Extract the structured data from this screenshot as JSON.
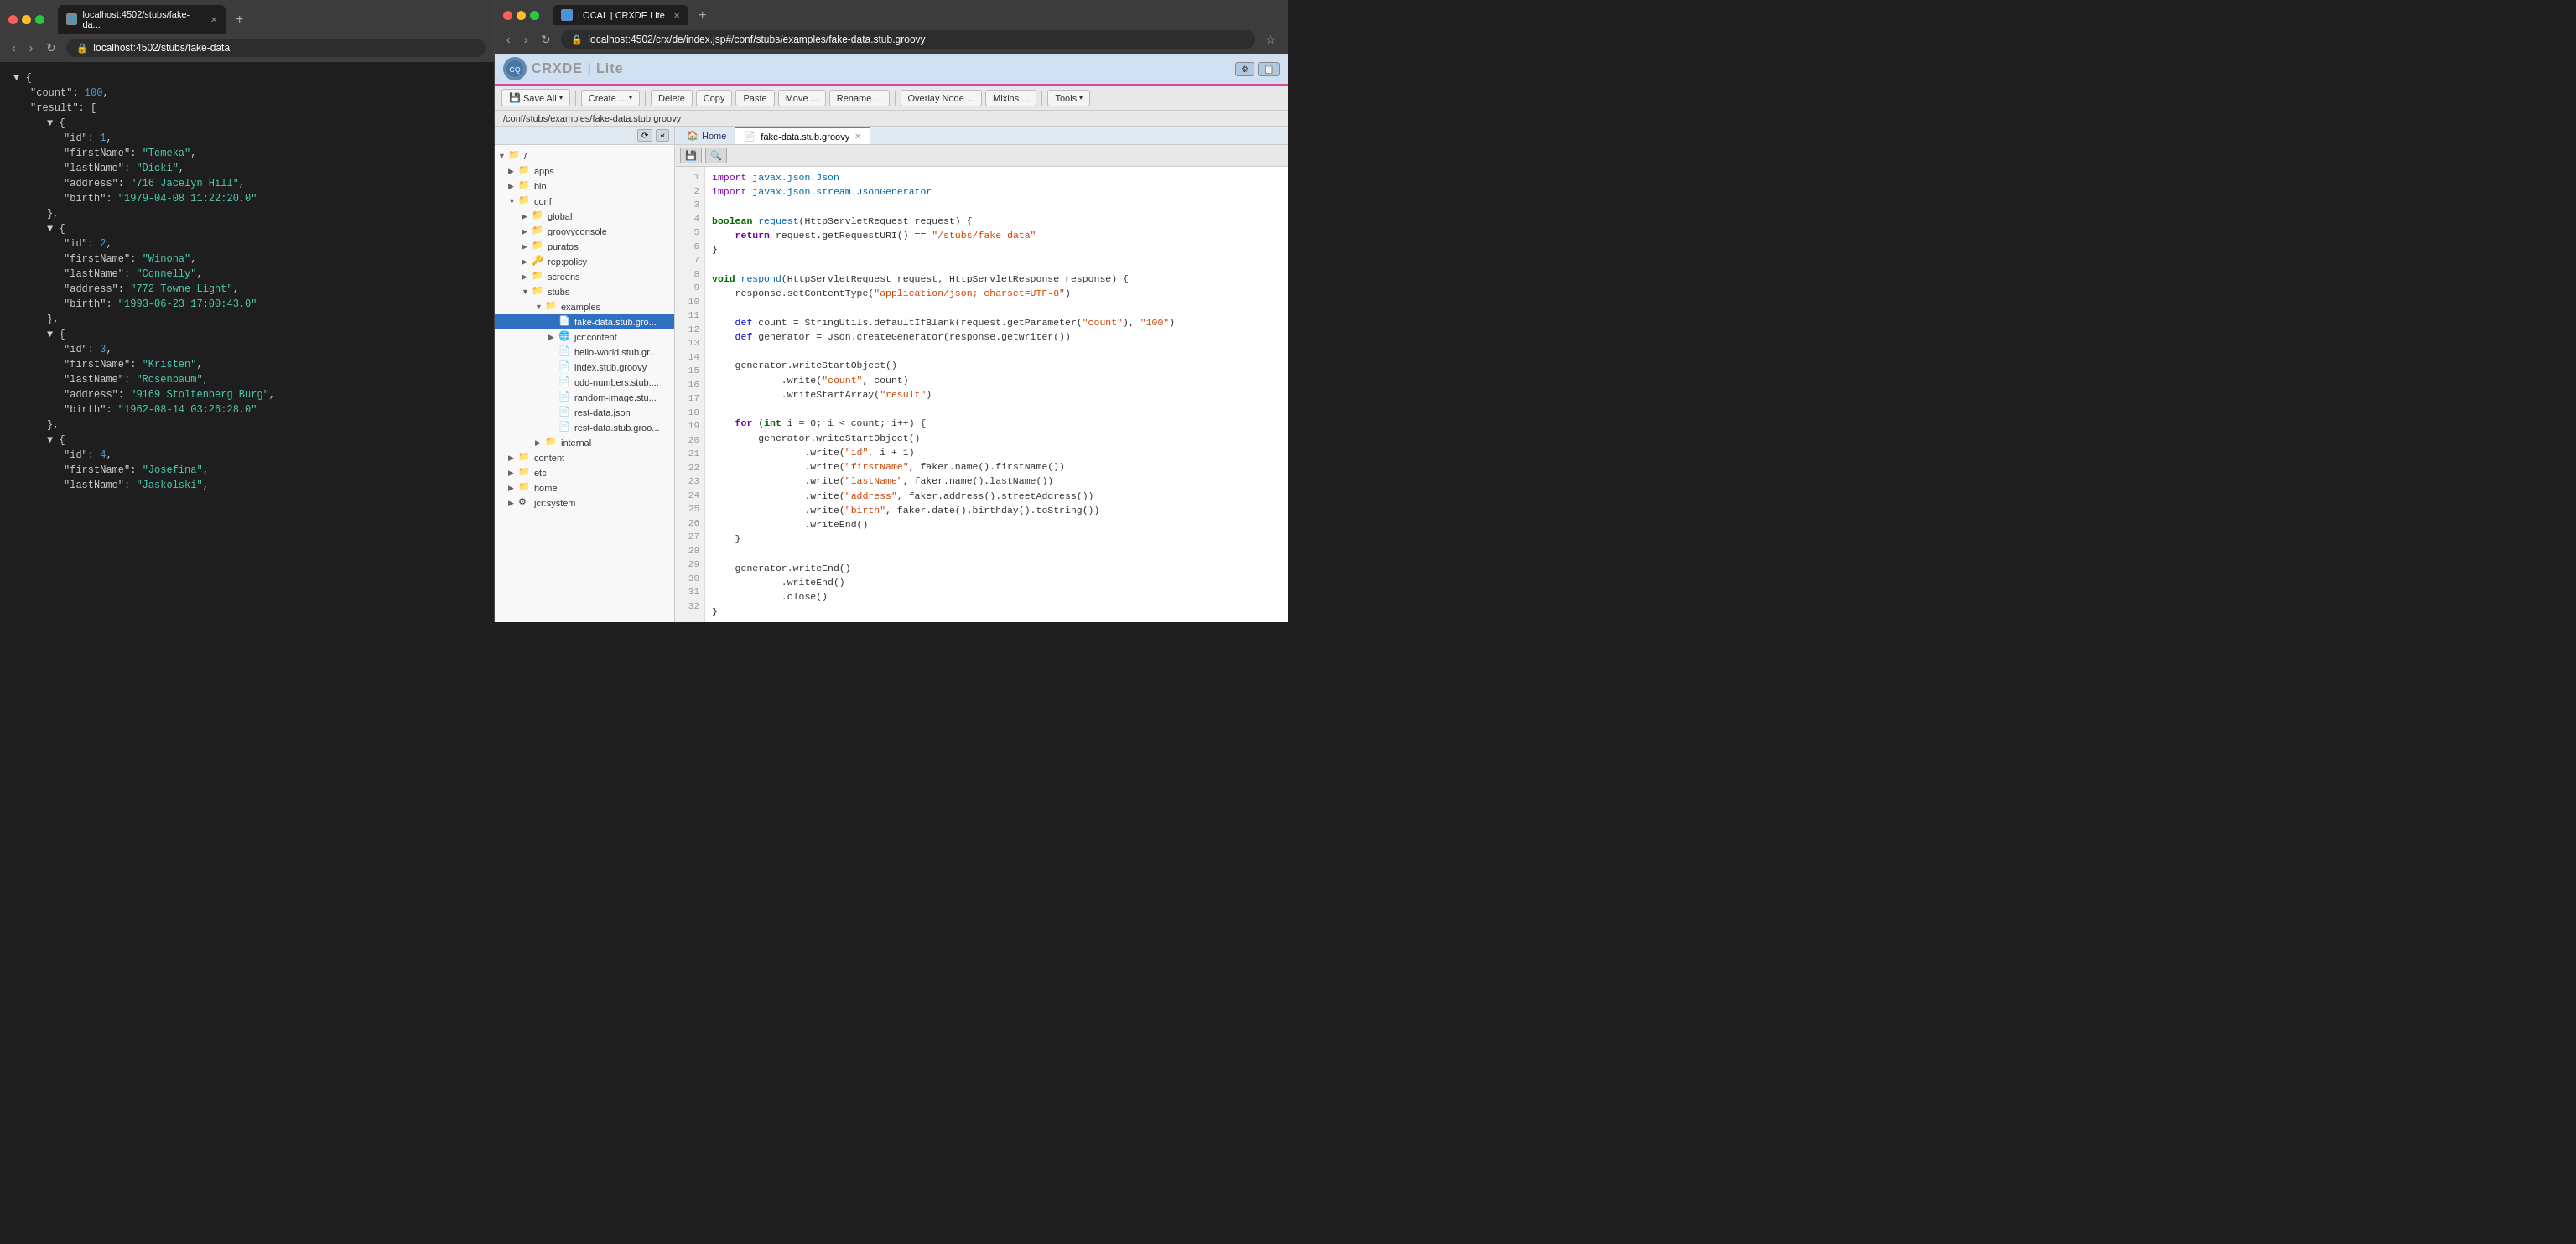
{
  "left_browser": {
    "tab_url": "localhost:4502/stubs/fake-da...",
    "address": "localhost:4502/stubs/fake-data",
    "json_lines": [
      {
        "indent": 0,
        "text": "▼ {"
      },
      {
        "indent": 1,
        "text": "\"count\": ",
        "number": "100",
        "suffix": ","
      },
      {
        "indent": 1,
        "text": "\"result\": ["
      },
      {
        "indent": 2,
        "text": "▼ {"
      },
      {
        "indent": 3,
        "key": "\"id\"",
        "colon": ": ",
        "number": "1",
        "suffix": ","
      },
      {
        "indent": 3,
        "key": "\"firstName\"",
        "colon": ": ",
        "string": "\"Temeka\"",
        "suffix": ","
      },
      {
        "indent": 3,
        "key": "\"lastName\"",
        "colon": ": ",
        "string": "\"Dicki\"",
        "suffix": ","
      },
      {
        "indent": 3,
        "key": "\"address\"",
        "colon": ": ",
        "string": "\"716 Jacelyn Hill\"",
        "suffix": ","
      },
      {
        "indent": 3,
        "key": "\"birth\"",
        "colon": ": ",
        "string": "\"1979-04-08 11:22:20.0\""
      },
      {
        "indent": 2,
        "text": "},"
      },
      {
        "indent": 2,
        "text": "▼ {"
      },
      {
        "indent": 3,
        "key": "\"id\"",
        "colon": ": ",
        "number": "2",
        "suffix": ","
      },
      {
        "indent": 3,
        "key": "\"firstName\"",
        "colon": ": ",
        "string": "\"Winona\"",
        "suffix": ","
      },
      {
        "indent": 3,
        "key": "\"lastName\"",
        "colon": ": ",
        "string": "\"Connelly\"",
        "suffix": ","
      },
      {
        "indent": 3,
        "key": "\"address\"",
        "colon": ": ",
        "string": "\"772 Towne Light\"",
        "suffix": ","
      },
      {
        "indent": 3,
        "key": "\"birth\"",
        "colon": ": ",
        "string": "\"1993-06-23 17:00:43.0\""
      },
      {
        "indent": 2,
        "text": "},"
      },
      {
        "indent": 2,
        "text": "▼ {"
      },
      {
        "indent": 3,
        "key": "\"id\"",
        "colon": ": ",
        "number": "3",
        "suffix": ","
      },
      {
        "indent": 3,
        "key": "\"firstName\"",
        "colon": ": ",
        "string": "\"Kristen\"",
        "suffix": ","
      },
      {
        "indent": 3,
        "key": "\"lastName\"",
        "colon": ": ",
        "string": "\"Rosenbaum\"",
        "suffix": ","
      },
      {
        "indent": 3,
        "key": "\"address\"",
        "colon": ": ",
        "string": "\"9169 Stoltenberg Burg\"",
        "suffix": ","
      },
      {
        "indent": 3,
        "key": "\"birth\"",
        "colon": ": ",
        "string": "\"1962-08-14 03:26:28.0\""
      },
      {
        "indent": 2,
        "text": "},"
      },
      {
        "indent": 2,
        "text": "▼ {"
      },
      {
        "indent": 3,
        "key": "\"id\"",
        "colon": ": ",
        "number": "4",
        "suffix": ","
      },
      {
        "indent": 3,
        "key": "\"firstName\"",
        "colon": ": ",
        "string": "\"Josefina\"",
        "suffix": ","
      },
      {
        "indent": 3,
        "key": "\"lastName\"",
        "colon": ": ",
        "string": "\"Jaskolski\"",
        "suffix": ","
      }
    ]
  },
  "right_browser": {
    "tab_title": "LOCAL | CRXDE Lite",
    "address": "localhost:4502/crx/de/index.jsp#/conf/stubs/examples/fake-data.stub.groovy",
    "crxde_title": "CRXDE",
    "crxde_subtitle": "Lite",
    "path": "/conf/stubs/examples/fake-data.stub.groovy",
    "toolbar": {
      "save_all": "Save All",
      "create": "Create ...",
      "delete": "Delete",
      "copy": "Copy",
      "paste": "Paste",
      "move": "Move ...",
      "rename": "Rename ...",
      "overlay_node": "Overlay Node ...",
      "mixins": "Mixins ...",
      "tools": "Tools"
    },
    "tabs": {
      "home": "Home",
      "active_file": "fake-data.stub.groovy"
    },
    "tree": {
      "root": "/",
      "items": [
        {
          "label": "apps",
          "level": 1,
          "expanded": false
        },
        {
          "label": "bin",
          "level": 1,
          "expanded": false
        },
        {
          "label": "conf",
          "level": 1,
          "expanded": true
        },
        {
          "label": "global",
          "level": 2,
          "expanded": false
        },
        {
          "label": "groovyconsole",
          "level": 2,
          "expanded": false
        },
        {
          "label": "puratos",
          "level": 2,
          "expanded": false
        },
        {
          "label": "rep:policy",
          "level": 2,
          "expanded": false
        },
        {
          "label": "screens",
          "level": 2,
          "expanded": false
        },
        {
          "label": "stubs",
          "level": 2,
          "expanded": true
        },
        {
          "label": "examples",
          "level": 3,
          "expanded": true
        },
        {
          "label": "fake-data.stub.gro...",
          "level": 4,
          "expanded": false,
          "selected": true
        },
        {
          "label": "jcr:content",
          "level": 4,
          "expanded": false
        },
        {
          "label": "hello-world.stub.gr...",
          "level": 4,
          "expanded": false
        },
        {
          "label": "index.stub.groovy",
          "level": 4,
          "expanded": false
        },
        {
          "label": "odd-numbers.stub....",
          "level": 4,
          "expanded": false
        },
        {
          "label": "random-image.stu...",
          "level": 4,
          "expanded": false
        },
        {
          "label": "rest-data.json",
          "level": 4,
          "expanded": false
        },
        {
          "label": "rest-data.stub.groo...",
          "level": 4,
          "expanded": false
        },
        {
          "label": "internal",
          "level": 3,
          "expanded": false
        },
        {
          "label": "content",
          "level": 1,
          "expanded": false
        },
        {
          "label": "etc",
          "level": 1,
          "expanded": false
        },
        {
          "label": "home",
          "level": 1,
          "expanded": false
        },
        {
          "label": "jcr:system",
          "level": 1,
          "expanded": false
        }
      ]
    },
    "code_lines": [
      {
        "num": 1,
        "content": "import javax.json.Json"
      },
      {
        "num": 2,
        "content": "import javax.json.stream.JsonGenerator"
      },
      {
        "num": 3,
        "content": ""
      },
      {
        "num": 4,
        "content": "boolean request(HttpServletRequest request) {"
      },
      {
        "num": 5,
        "content": "    return request.getRequestURI() == \"/stubs/fake-data\""
      },
      {
        "num": 6,
        "content": "}"
      },
      {
        "num": 7,
        "content": ""
      },
      {
        "num": 8,
        "content": "void respond(HttpServletRequest request, HttpServletResponse response) {"
      },
      {
        "num": 9,
        "content": "    response.setContentType(\"application/json; charset=UTF-8\")"
      },
      {
        "num": 10,
        "content": ""
      },
      {
        "num": 11,
        "content": "    def count = StringUtils.defaultIfBlank(request.getParameter(\"count\"), \"100\")"
      },
      {
        "num": 12,
        "content": "    def generator = Json.createGenerator(response.getWriter())"
      },
      {
        "num": 13,
        "content": ""
      },
      {
        "num": 14,
        "content": "    generator.writeStartObject()"
      },
      {
        "num": 15,
        "content": "            .write(\"count\", count)"
      },
      {
        "num": 16,
        "content": "            .writeStartArray(\"result\")"
      },
      {
        "num": 17,
        "content": ""
      },
      {
        "num": 18,
        "content": "    for (int i = 0; i < count; i++) {"
      },
      {
        "num": 19,
        "content": "        generator.writeStartObject()"
      },
      {
        "num": 20,
        "content": "                .write(\"id\", i + 1)"
      },
      {
        "num": 21,
        "content": "                .write(\"firstName\", faker.name().firstName())"
      },
      {
        "num": 22,
        "content": "                .write(\"lastName\", faker.name().lastName())"
      },
      {
        "num": 23,
        "content": "                .write(\"address\", faker.address().streetAddress())"
      },
      {
        "num": 24,
        "content": "                .write(\"birth\", faker.date().birthday().toString())"
      },
      {
        "num": 25,
        "content": "                .writeEnd()"
      },
      {
        "num": 26,
        "content": "    }"
      },
      {
        "num": 27,
        "content": ""
      },
      {
        "num": 28,
        "content": "    generator.writeEnd()"
      },
      {
        "num": 29,
        "content": "            .writeEnd()"
      },
      {
        "num": 30,
        "content": "            .close()"
      },
      {
        "num": 31,
        "content": "}"
      },
      {
        "num": 32,
        "content": ""
      }
    ]
  }
}
